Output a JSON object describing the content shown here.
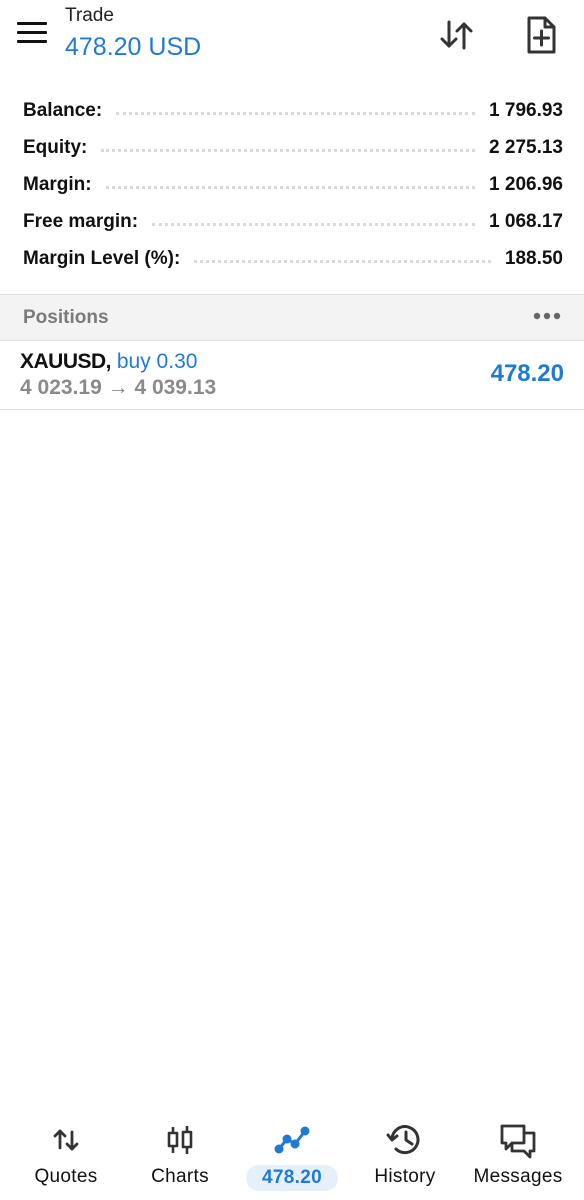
{
  "header": {
    "title": "Trade",
    "subtitle": "478.20 USD",
    "icons": [
      "menu-icon",
      "sort-arrows-icon",
      "new-order-icon"
    ]
  },
  "summary": [
    {
      "label": "Balance:",
      "value": "1 796.93"
    },
    {
      "label": "Equity:",
      "value": "2 275.13"
    },
    {
      "label": "Margin:",
      "value": "1 206.96"
    },
    {
      "label": "Free margin:",
      "value": "1 068.17"
    },
    {
      "label": "Margin Level (%):",
      "value": "188.50"
    }
  ],
  "positions": {
    "title": "Positions",
    "items": [
      {
        "symbol": "XAUUSD,",
        "side": "buy 0.30",
        "open_price": "4 023.19",
        "arrow": "→",
        "current_price": "4 039.13",
        "profit": "478.20"
      }
    ]
  },
  "nav": [
    {
      "label": "Quotes",
      "icon": "quotes-icon"
    },
    {
      "label": "Charts",
      "icon": "charts-icon"
    },
    {
      "label": "478.20",
      "icon": "trade-icon",
      "active": true
    },
    {
      "label": "History",
      "icon": "history-icon"
    },
    {
      "label": "Messages",
      "icon": "messages-icon"
    }
  ],
  "colors": {
    "accent": "#1f7ad6",
    "muted": "#8a8a8a",
    "section_bg": "#f3f3f3"
  }
}
